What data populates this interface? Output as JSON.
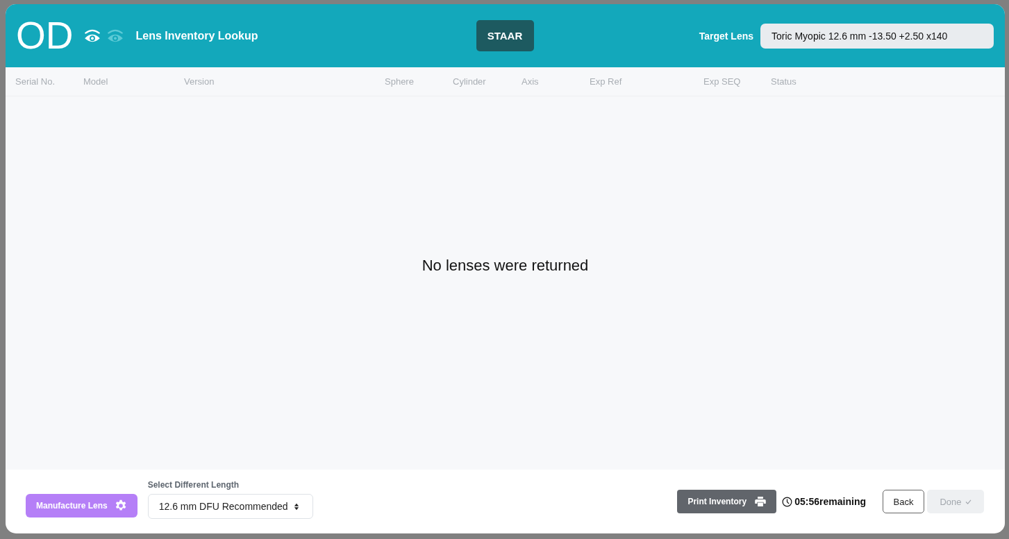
{
  "header": {
    "eye_code": "OD",
    "eyes": [
      {
        "selected": true
      },
      {
        "selected": false
      }
    ],
    "title": "Lens Inventory Lookup",
    "manufacturer": "STAAR",
    "target_label": "Target Lens",
    "target_value": "Toric Myopic 12.6 mm -13.50 +2.50 x140"
  },
  "table": {
    "columns": [
      "Serial No.",
      "Model",
      "Version",
      "Sphere",
      "Cylinder",
      "Axis",
      "Exp Ref",
      "Exp SEQ",
      "Status"
    ],
    "empty_message": "No lenses were returned"
  },
  "footer": {
    "manufacture_button": "Manufacture Lens",
    "length_label": "Select Different Length",
    "length_value": "12.6 mm DFU Recommended",
    "print_button": "Print Inventory",
    "timer": "05:56",
    "timer_suffix": "remaining",
    "back_button": "Back",
    "done_button": {
      "label": "Done",
      "disabled": true
    }
  }
}
